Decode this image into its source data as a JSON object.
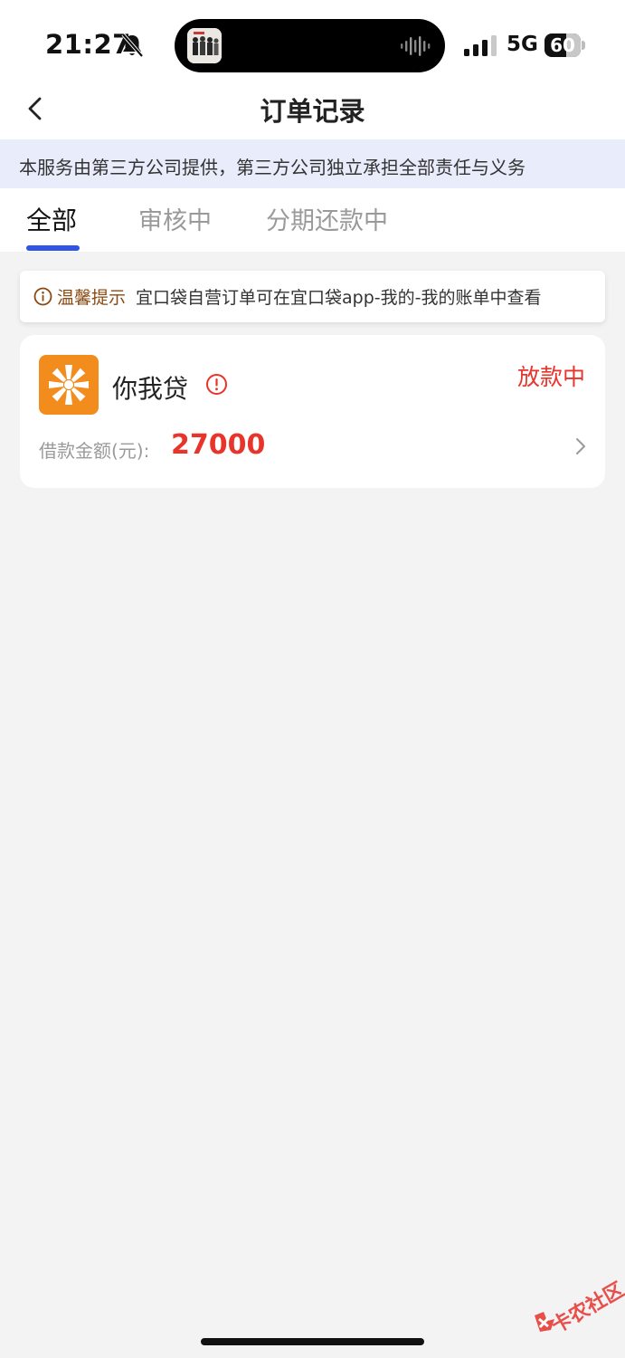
{
  "status_bar": {
    "time": "21:27",
    "network": "5G",
    "battery_percent": "60",
    "battery_level": 0.6,
    "icons": [
      "bell-off-icon",
      "sound-wave-icon",
      "signal-bars-icon"
    ]
  },
  "nav": {
    "title": "订单记录",
    "back_icon": "chevron-left-icon"
  },
  "notice": {
    "text": "本服务由第三方公司提供，第三方公司独立承担全部责任与义务"
  },
  "tabs": [
    {
      "label": "全部",
      "active": true
    },
    {
      "label": "审核中",
      "active": false
    },
    {
      "label": "分期还款中",
      "active": false
    }
  ],
  "tip": {
    "label": "温馨提示",
    "text": "宜口袋自营订单可在宜口袋app-我的-我的账单中查看",
    "icon": "info-icon"
  },
  "orders": [
    {
      "lender": "你我贷",
      "status": "放款中",
      "amount_label": "借款金额(元):",
      "amount": "27000",
      "icons": [
        "brand-logo",
        "alert-icon",
        "chevron-right-icon"
      ]
    }
  ],
  "watermark": {
    "text": "卡农社区"
  },
  "colors": {
    "accent": "#2f55e8",
    "status_red": "#e8342b",
    "notice_bg": "#e8ecfb",
    "tip_label": "#8a4a12",
    "logo_orange": "#f28c1c",
    "page_bg": "#f3f3f4"
  }
}
